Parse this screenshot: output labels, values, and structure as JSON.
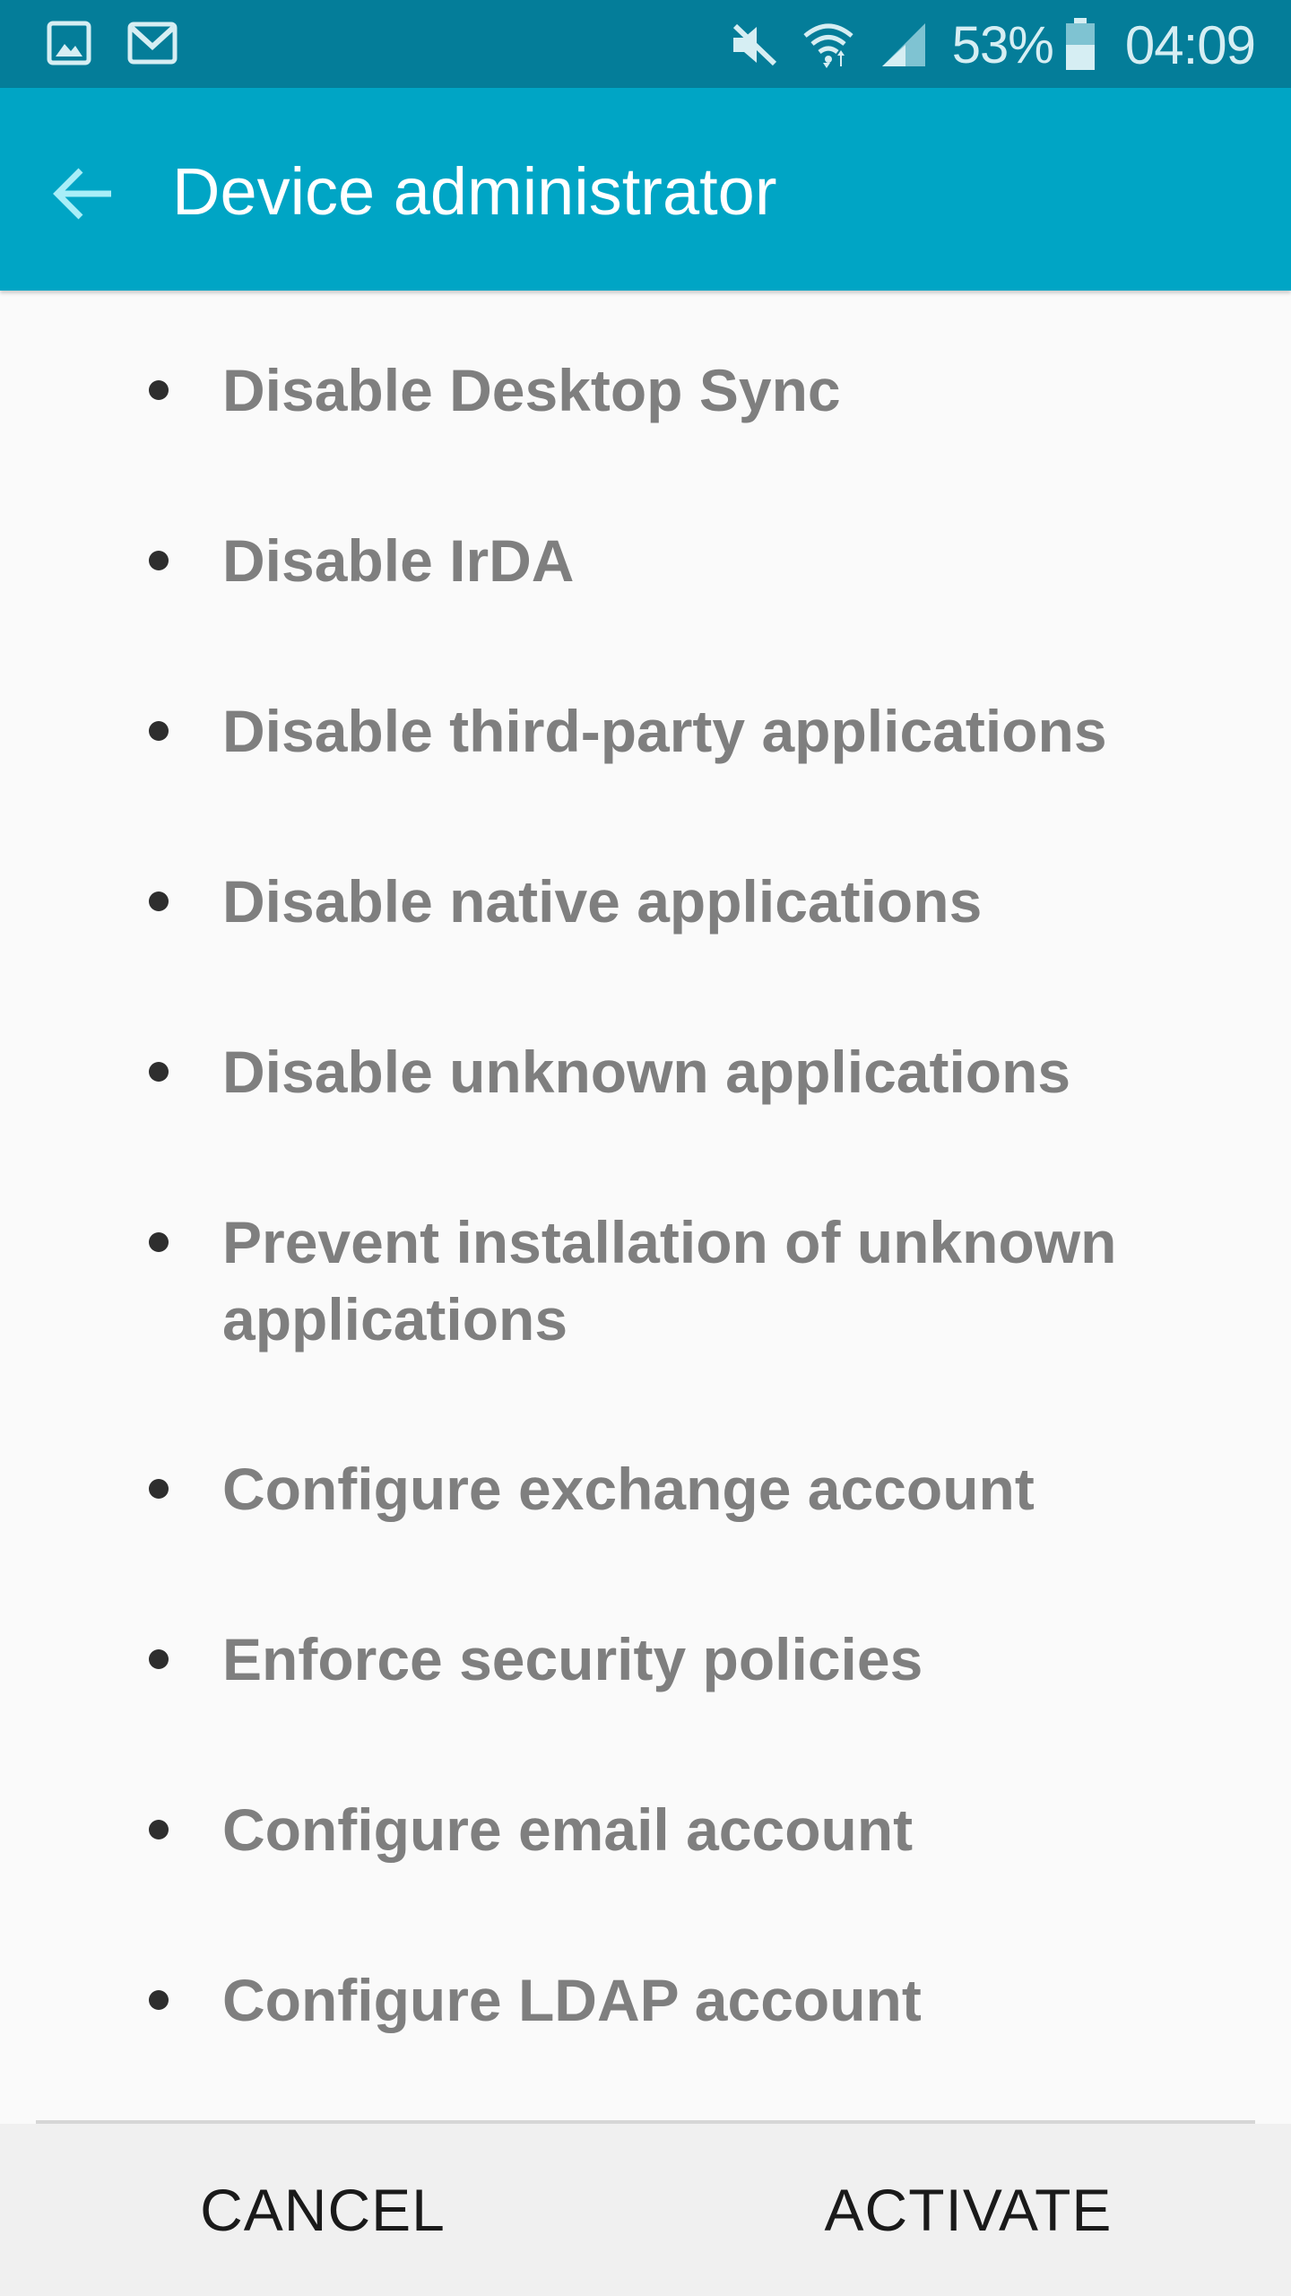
{
  "status_bar": {
    "left_icons": [
      "gallery-icon",
      "gmail-icon"
    ],
    "right_icons": [
      "mute-icon",
      "wifi-icon",
      "signal-icon"
    ],
    "battery_percent": "53%",
    "battery_level": 0.53,
    "time": "04:09"
  },
  "app_bar": {
    "back_icon": "arrow-left-icon",
    "title": "Device administrator"
  },
  "policies": [
    "Disable Desktop Sync",
    "Disable IrDA",
    "Disable third-party applications",
    "Disable native applications",
    "Disable unknown applications",
    "Prevent installation of unknown applications",
    "Configure exchange account",
    "Enforce security policies",
    "Configure email account",
    "Configure LDAP account"
  ],
  "buttons": {
    "cancel": "CANCEL",
    "activate": "ACTIVATE"
  },
  "colors": {
    "status_bar": "#047d99",
    "app_bar": "#00a5c5",
    "back_arrow": "#a8eef8",
    "policy_text": "#7f7f7f"
  }
}
